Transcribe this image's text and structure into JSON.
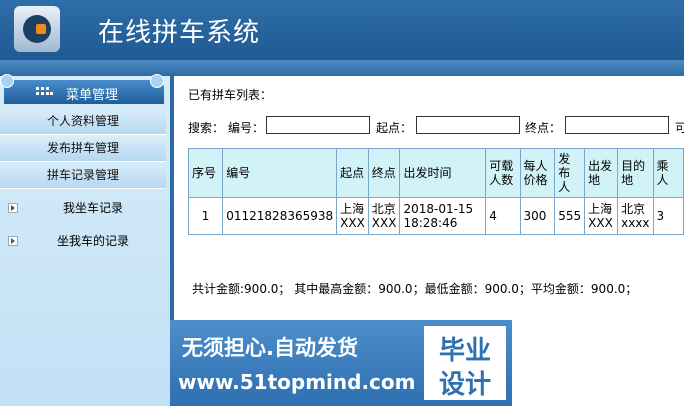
{
  "app": {
    "title": "在线拼车系统"
  },
  "sidebar": {
    "menu_header": "菜单管理",
    "items": [
      "个人资料管理",
      "发布拼车管理",
      "拼车记录管理"
    ],
    "links": [
      "我坐车记录",
      "坐我车的记录"
    ]
  },
  "main": {
    "list_title": "已有拼车列表：",
    "search": {
      "label": "搜索：",
      "field_number": "编号：",
      "field_from": "起点：",
      "field_to": "终点：",
      "field_more": "可"
    },
    "table": {
      "headers": [
        "序号",
        "编号",
        "起点",
        "终点",
        "出发时间",
        "可载人数",
        "每人价格",
        "发布人",
        "出发地",
        "目的地",
        "乘人"
      ],
      "rows": [
        [
          "1",
          "01121828365938",
          "上海XXX",
          "北京XXX",
          "2018-01-15 18:28:46",
          "4",
          "300",
          "555",
          "上海XXX",
          "北京xxxx",
          "3"
        ]
      ]
    },
    "summary": "共计金额:900.0； 其中最高金额：900.0；最低金额：900.0；平均金额：900.0；"
  },
  "ad": {
    "line1": "无须担心.自动发货",
    "line2": "www.51topmind.com",
    "box_line1": "毕业",
    "box_line2": "设计"
  }
}
